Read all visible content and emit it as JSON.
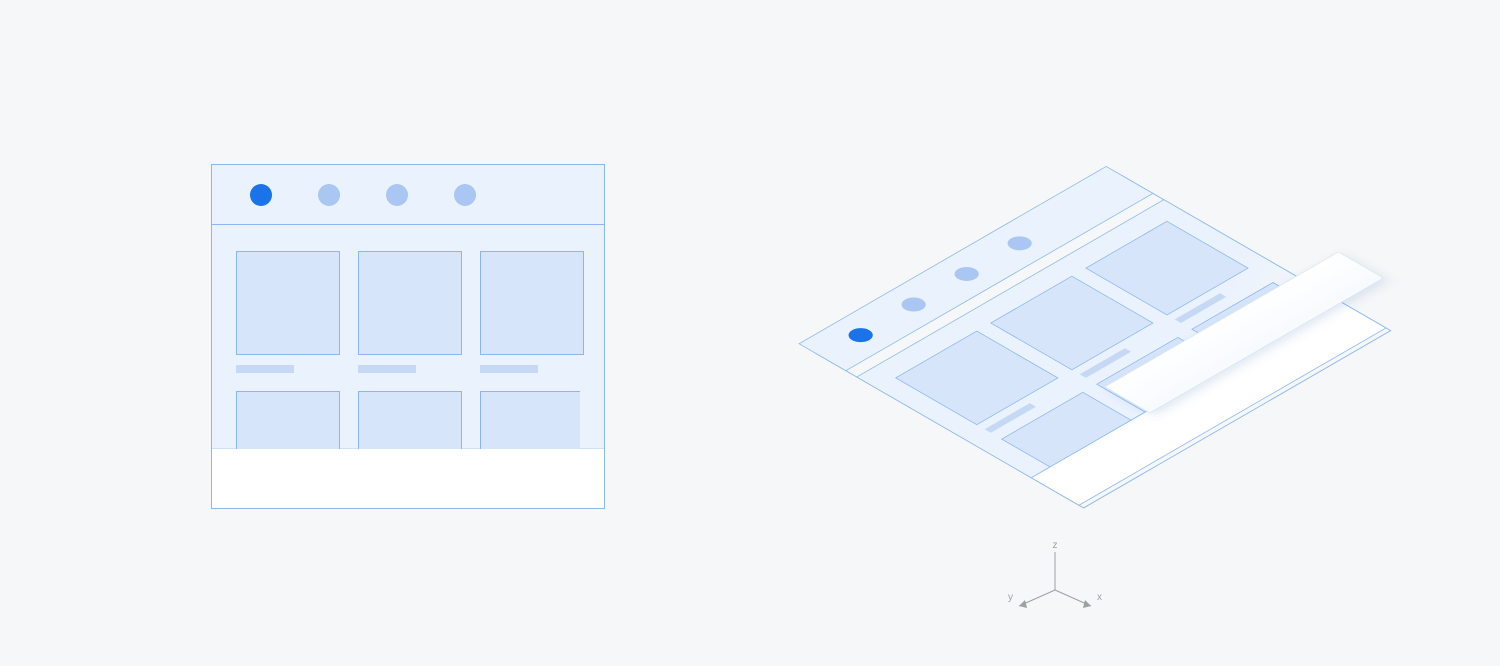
{
  "colors": {
    "page_bg": "#f6f7f8",
    "panel_bg": "#eaf2fd",
    "panel_border": "#8bb7f0",
    "thumb_fill": "#d6e5fa",
    "caption_fill": "#c6d9f4",
    "tab_inactive": "#a9c7f2",
    "tab_active": "#1a73e8",
    "axis": "#9aa0a6"
  },
  "flat": {
    "tabs": [
      {
        "active": true
      },
      {
        "active": false
      },
      {
        "active": false
      },
      {
        "active": false
      }
    ],
    "grid_rows": 2,
    "grid_cols": 3
  },
  "iso": {
    "tabs": [
      {
        "active": true
      },
      {
        "active": false
      },
      {
        "active": false
      },
      {
        "active": false
      }
    ],
    "grid_rows": 2,
    "grid_cols": 3,
    "layers": [
      "outline",
      "header-tabs",
      "content-grid",
      "floating-sheet"
    ]
  },
  "axis": {
    "z": "z",
    "y": "y",
    "x": "x"
  }
}
